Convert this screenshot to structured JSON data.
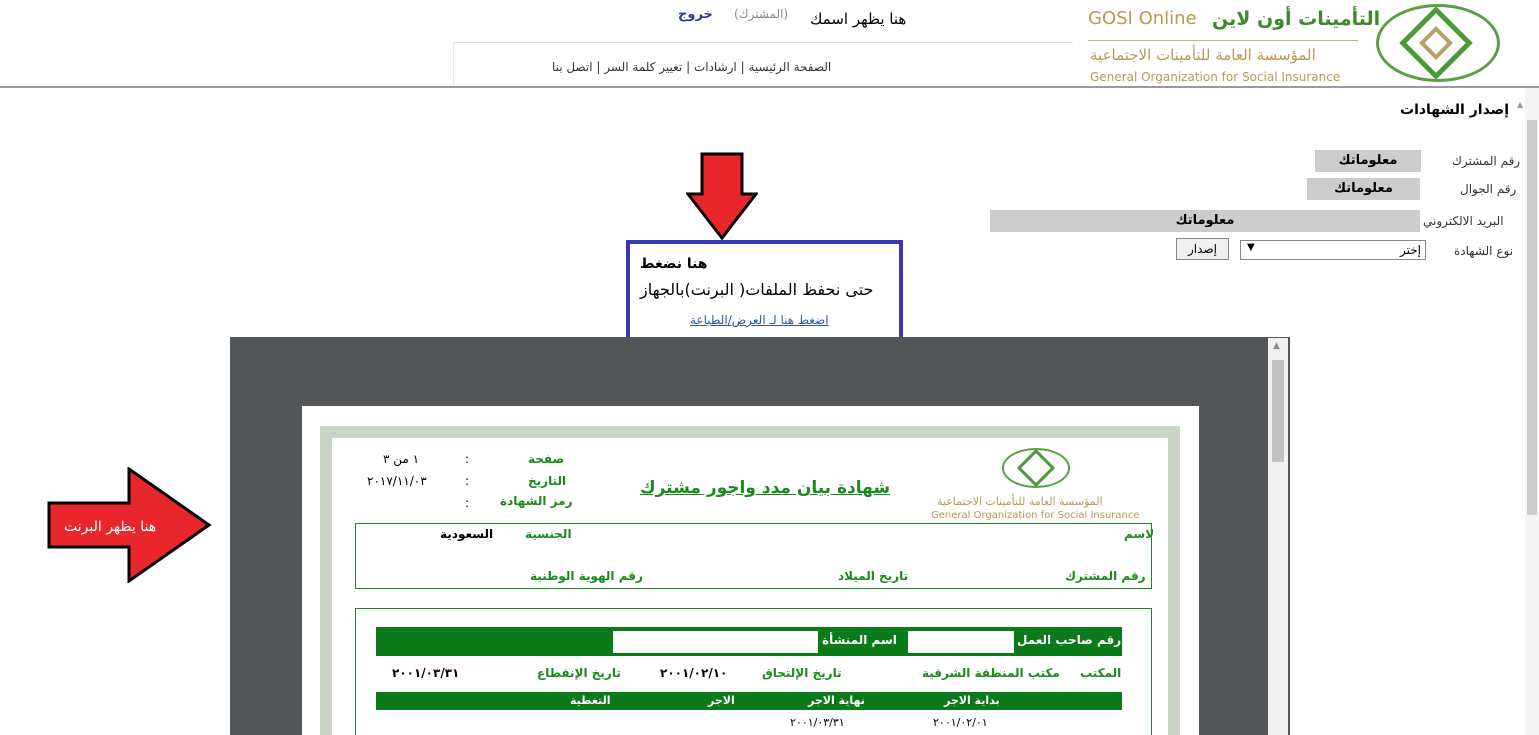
{
  "header": {
    "brand_ar": "التأمينات أون لاين",
    "brand_en": "GOSI Online",
    "brand_sub_ar": "المؤسسة العامة للتأمينات الاجتماعية",
    "brand_sub_en": "General Organization for Social Insurance",
    "welcome_text": "هنا يظهر اسمك",
    "subscriber_tag": "(المشترك)",
    "logout_label": "خروج",
    "nav": {
      "home": "الصفحة الرئيسية",
      "guidance": "ارشادات",
      "change_password": "تغيير كلمة السر",
      "contact": "اتصل بنا",
      "sep": " | "
    }
  },
  "form": {
    "section_title": "إصدار الشهادات",
    "subscriber_no_label": "رقم المشترك",
    "subscriber_no_value": "معلوماتك",
    "mobile_label": "رقم الجوال",
    "mobile_value": "معلوماتك",
    "email_label": "البريد الالكتروني",
    "email_value": "معلوماتك",
    "cert_type_label": "نوع الشهادة",
    "cert_type_selected": "إختر",
    "issue_button": "إصدار"
  },
  "annotation": {
    "line1": "هنا نضغط",
    "line2": "حتى نحفظ الملفات( البرنت)بالجهاز",
    "view_print_link": "اضغط هنا لـ العرض/الطباعة",
    "right_arrow_label": "هنا يظهر البرنت",
    "arrow_color": "#e8262b",
    "callout_color": "#3838b8"
  },
  "certificate": {
    "org_ar": "المؤسسة العامة للتأمينات الاجتماعية",
    "org_en": "General Organization for Social Insurance",
    "title": "شهادة بيان مدد واجور مشترك",
    "page_label": "صفحة",
    "page_value": "١ من ٣",
    "date_label": "التاريخ",
    "date_value": "٢٠١٧/١١/٠٣",
    "cert_code_label": "رمز الشهادة",
    "colon": ":",
    "name_label": "لاسم",
    "nationality_label": "الجنسية",
    "nationality_value": "السعودية",
    "subscriber_no_label": "رقم المشترك",
    "birth_date_label": "تاريخ الميلاد",
    "national_id_label": "رقم الهوية الوطنية",
    "employer_no_label": "رقم صاحب العمل",
    "establishment_name_label": "اسم المنشأة",
    "office_label": "المكتب",
    "office_value": "مكتب المنطقة الشرقية",
    "join_date_label": "تاريخ الإلتحاق",
    "join_date_value": "٢٠٠١/٠٢/١٠",
    "end_date_label": "تاريخ الإنقطاع",
    "end_date_value": "٢٠٠١/٠٣/٣١",
    "cols": {
      "wage_start": "بداية الاجر",
      "wage_end": "نهاية الاجر",
      "wage": "الاجر",
      "coverage": "التغطية"
    },
    "row1": {
      "wage_start": "٢٠٠١/٠٢/٠١",
      "wage_end": "٢٠٠١/٠٣/٣١"
    }
  }
}
